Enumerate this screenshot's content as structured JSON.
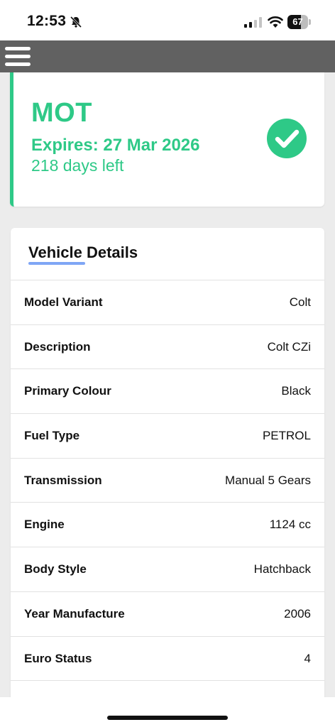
{
  "status_bar": {
    "time": "12:53",
    "battery_level": "67",
    "battery_fraction": 0.67
  },
  "mot": {
    "title": "MOT",
    "expires": "Expires: 27 Mar 2026",
    "days_left": "218 days left",
    "status_icon": "check-circle-icon",
    "accent_color": "#2ec987"
  },
  "vehicle_details": {
    "title": "Vehicle Details",
    "rows": [
      {
        "label": "Model Variant",
        "value": "Colt"
      },
      {
        "label": "Description",
        "value": "Colt CZi"
      },
      {
        "label": "Primary Colour",
        "value": "Black"
      },
      {
        "label": "Fuel Type",
        "value": "PETROL"
      },
      {
        "label": "Transmission",
        "value": "Manual 5 Gears"
      },
      {
        "label": "Engine",
        "value": "1124 cc"
      },
      {
        "label": "Body Style",
        "value": "Hatchback"
      },
      {
        "label": "Year Manufacture",
        "value": "2006"
      },
      {
        "label": "Euro Status",
        "value": "4"
      }
    ]
  },
  "colors": {
    "nav_bar": "#616161",
    "underline": "#7fa6f5"
  }
}
